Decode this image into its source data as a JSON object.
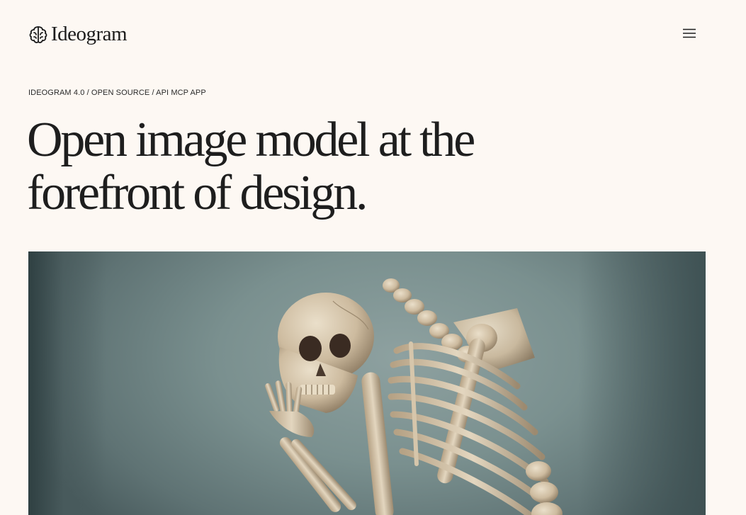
{
  "brand": {
    "name": "Ideogram",
    "logo_icon": "brain-icon"
  },
  "header": {
    "menu_icon": "hamburger-menu-icon"
  },
  "hero": {
    "eyebrow": "IDEOGRAM 4.0 / OPEN SOURCE / API MCP APP",
    "headline_line1": "Open image model at the",
    "headline_line2": "forefront of design."
  },
  "colors": {
    "background": "#fdf8f3",
    "text": "#1c1c1c",
    "image_backdrop": "#7a908f",
    "bone": "#d9c9b0"
  }
}
